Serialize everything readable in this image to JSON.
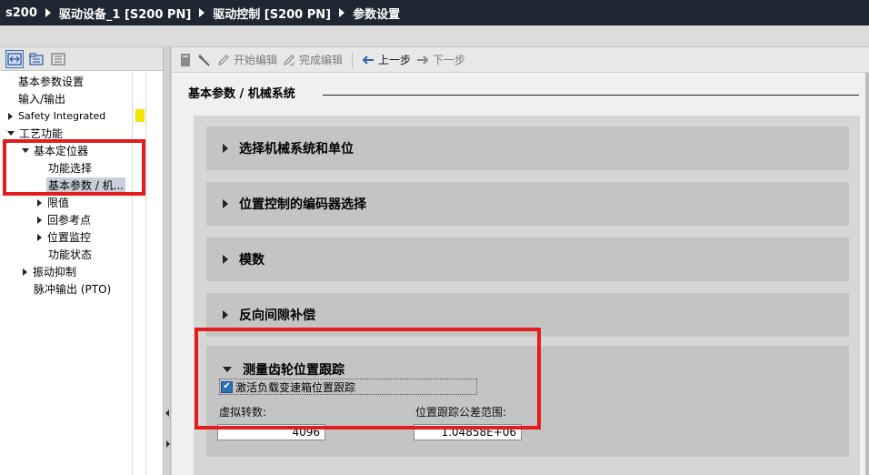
{
  "breadcrumb": [
    "s200",
    "驱动设备_1 [S200 PN]",
    "驱动控制 [S200 PN]",
    "参数设置"
  ],
  "tree": {
    "items": [
      {
        "label": "基本参数设置",
        "indent": 0,
        "arrow": "none"
      },
      {
        "label": "输入/输出",
        "indent": 0,
        "arrow": "none"
      },
      {
        "label": "Safety Integrated",
        "indent": 0,
        "arrow": "right"
      },
      {
        "label": "工艺功能",
        "indent": 0,
        "arrow": "down"
      },
      {
        "label": "基本定位器",
        "indent": 1,
        "arrow": "down"
      },
      {
        "label": "功能选择",
        "indent": 2,
        "arrow": "none"
      },
      {
        "label": "基本参数 / 机...",
        "indent": 2,
        "arrow": "none"
      },
      {
        "label": "限值",
        "indent": 2,
        "arrow": "right"
      },
      {
        "label": "回参考点",
        "indent": 2,
        "arrow": "right"
      },
      {
        "label": "位置监控",
        "indent": 2,
        "arrow": "right"
      },
      {
        "label": "功能状态",
        "indent": 2,
        "arrow": "none"
      },
      {
        "label": "振动抑制",
        "indent": 1,
        "arrow": "right"
      },
      {
        "label": "脉冲输出 (PTO)",
        "indent": 1,
        "arrow": "none"
      }
    ]
  },
  "toolbar": {
    "start_edit": "开始编辑",
    "finish_edit": "完成编辑",
    "prev": "上一步",
    "next": "下一步"
  },
  "page_title": "基本参数 / 机械系统",
  "sections": [
    "选择机械系统和单位",
    "位置控制的编码器选择",
    "模数",
    "反向间隙补偿"
  ],
  "open_section": {
    "title": "测量齿轮位置跟踪",
    "checkbox_label": "激活负载变速箱位置跟踪",
    "checkbox_checked": true,
    "virtual_revs_label": "虚拟转数:",
    "virtual_revs_value": "4096",
    "tolerance_label": "位置跟踪公差范围:",
    "tolerance_value": "1.04858E+06"
  },
  "colors": {
    "titlebar": "#1f2733",
    "highlight_red": "#e31c1c",
    "safety_marker": "#f5e400",
    "checkbox": "#2f6fb3"
  }
}
